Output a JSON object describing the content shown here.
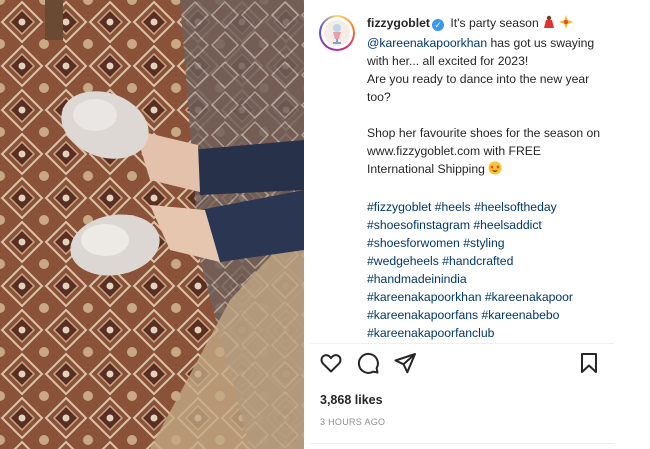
{
  "post": {
    "username": "fizzygoblet",
    "caption": {
      "intro": "It's party season",
      "mention": "@kareenakapoorkhan",
      "line_after_mention": "has got us swaying with her... all excited for 2023!",
      "question": "Are you ready to dance into the new year too?",
      "shop_line": "Shop her favourite shoes for the season on www.fizzygoblet.com with FREE International Shipping"
    },
    "hashtags": [
      "#fizzygoblet",
      "#heels",
      "#heelsoftheday",
      "#shoesofinstagram",
      "#heelsaddict",
      "#shoesforwomen",
      "#styling",
      "#wedgeheels",
      "#handcrafted",
      "#handmadeinindia",
      "#kareenakapoorkhan",
      "#kareenakapoor",
      "#kareenakapoorfans",
      "#kareenabebo",
      "#kareenakapoorfanclub"
    ],
    "likes": "3,868 likes",
    "time_ago": "3 HOURS AGO"
  },
  "icons": {
    "verified": "verified-badge-icon",
    "like": "heart-icon",
    "comment": "comment-icon",
    "share": "send-icon",
    "save": "bookmark-icon",
    "emoji_1": "dancer-emoji",
    "emoji_2": "sparkle-burst-emoji",
    "emoji_3": "star-struck-emoji"
  },
  "colors": {
    "text": "#262626",
    "link": "#00376b",
    "muted": "#8e8e8e",
    "verified": "#3897f0"
  }
}
